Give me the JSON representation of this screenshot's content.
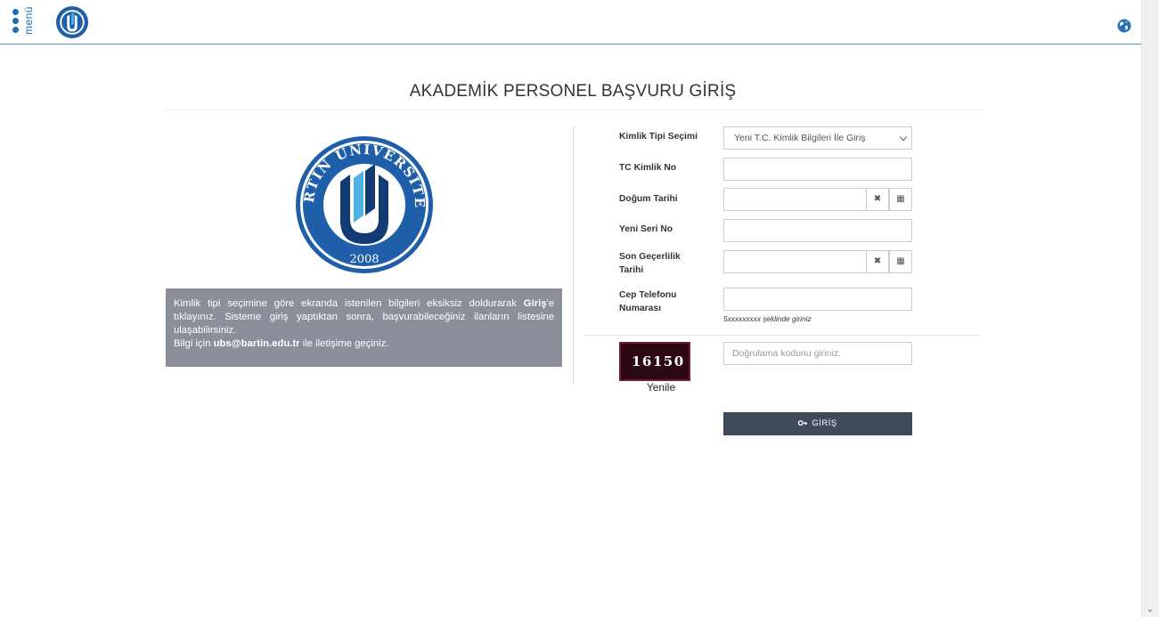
{
  "header": {
    "menu_label": "menü",
    "logo_icon": "university-logo-icon",
    "globe_icon": "globe-icon"
  },
  "page": {
    "title": "AKADEMİK PERSONEL BAŞVURU GİRİŞ"
  },
  "logo": {
    "ring_text": "BARTIN ÜNİVERSİTESİ",
    "year": "2008",
    "colors": {
      "ring": "#1f5ea8",
      "dark": "#123b73",
      "accent": "#4db3e6"
    }
  },
  "info": {
    "line1_pre": "Kimlik tipi seçimine göre ekranda istenilen bilgileri eksiksiz doldurarak ",
    "line1_bold": "Giriş",
    "line1_post": "'e tıklayınız. Sisteme giriş yaptıktan sonra, başvurabileceğiniz ilanların listesine ulaşabilirsiniz.",
    "contact_pre": "Bilgi için ",
    "contact_email": "ubs@bartin.edu.tr",
    "contact_post": " ile iletişime geçiniz."
  },
  "form": {
    "id_type_label": "Kimlik Tipi Seçimi",
    "id_type_value": "Yeni T.C. Kimlik Bilgileri İle Giriş",
    "tc_label": "TC Kimlik No",
    "birth_label": "Doğum Tarihi",
    "serial_label": "Yeni Seri No",
    "expiry_label_1": "Son Geçerlilik",
    "expiry_label_2": "Tarihi",
    "phone_label_1": "Cep Telefonu",
    "phone_label_2": "Numarası",
    "phone_hint": "5xxxxxxxxx şeklinde giriniz",
    "clear_glyph": "✖",
    "calendar_glyph": "▦"
  },
  "captcha": {
    "code": "16150",
    "refresh_label": "Yenile",
    "placeholder": "Doğrulama kodunu giriniz.",
    "bg_color": "#2b0711"
  },
  "submit": {
    "label": "GİRİŞ",
    "icon": "key-icon",
    "color": "#404a5b"
  }
}
